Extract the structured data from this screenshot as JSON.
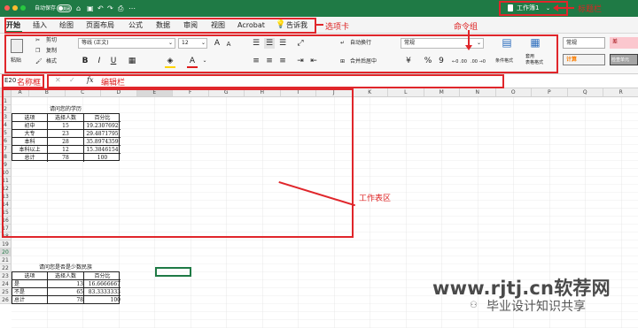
{
  "titlebar": {
    "autosave_label": "自动保存",
    "autosave_state": "关闭",
    "workbook_title": "工作簿1",
    "annotation": "标题栏"
  },
  "tabs": [
    "开始",
    "插入",
    "绘图",
    "页面布局",
    "公式",
    "数据",
    "审阅",
    "视图",
    "Acrobat",
    "告诉我"
  ],
  "tabs_annotation": "选项卡",
  "ribbon": {
    "annotation": "命令组",
    "paste": "粘贴",
    "cut": "剪切",
    "copy": "复制",
    "format_painter": "格式",
    "font_name": "等线 (正文)",
    "font_size": "12",
    "bold": "B",
    "italic": "I",
    "underline": "U",
    "wrap_text": "自动换行",
    "merge_center": "合并后居中",
    "number_format": "常规",
    "percent": "%",
    "comma": "9",
    "inc_decimal": "←0 .00",
    "dec_decimal": ".00 →0",
    "conditional_format": "条件格式",
    "table_format": "套用\n表格格式",
    "style_normal": "常规",
    "style_bad": "差",
    "style_calc": "计算",
    "style_check": "检查单元"
  },
  "formula_bar": {
    "name_box": "E20",
    "name_annotation": "名称框",
    "fx": "fx",
    "edit_annotation": "编辑栏"
  },
  "grid": {
    "columns": [
      "A",
      "B",
      "C",
      "D",
      "E",
      "F",
      "G",
      "H",
      "I",
      "J",
      "K",
      "L",
      "M",
      "N",
      "O",
      "P",
      "Q",
      "R"
    ],
    "rows": [
      "1",
      "2",
      "3",
      "4",
      "5",
      "6",
      "7",
      "8",
      "9",
      "10",
      "11",
      "12",
      "13",
      "14",
      "15",
      "16",
      "17",
      "18",
      "19",
      "20",
      "21",
      "22",
      "23",
      "24",
      "25",
      "26"
    ],
    "workarea_annotation": "工作表区",
    "table1": {
      "title": "请问您的学历",
      "headers": [
        "选项",
        "选择人数",
        "百分比"
      ],
      "rows": [
        [
          "初中",
          "15",
          "19.2307692"
        ],
        [
          "大专",
          "23",
          "29.4871795"
        ],
        [
          "本科",
          "28",
          "35.8974359"
        ],
        [
          "本科以上",
          "12",
          "15.3846154"
        ],
        [
          "总计",
          "78",
          "100"
        ]
      ]
    },
    "table2": {
      "title": "请问您是否是少数民族",
      "headers": [
        "选项",
        "选择人数",
        "百分比"
      ],
      "rows": [
        [
          "是",
          "13",
          "16.6666667"
        ],
        [
          "不是",
          "65",
          "83.3333333"
        ],
        [
          "总计",
          "78",
          "100"
        ]
      ]
    }
  },
  "watermark": {
    "url": "www.rjtj.cn软荐网",
    "sub": "毕业设计知识共享"
  }
}
